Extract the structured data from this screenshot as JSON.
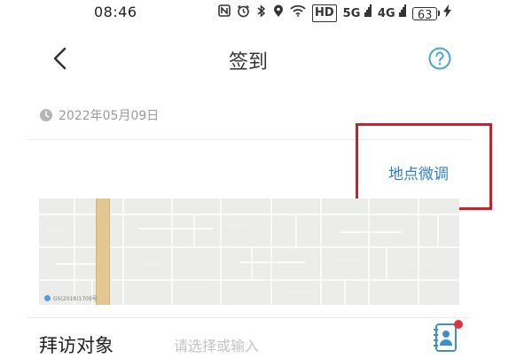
{
  "status_bar": {
    "time": "08:46",
    "network_1": "5G",
    "network_2": "4G",
    "battery": "63",
    "hd_badge": "HD"
  },
  "header": {
    "title": "签到"
  },
  "date": "2022年05月09日",
  "location_adjust": "地点微调",
  "map": {
    "credit": "GS(2018)1709号"
  },
  "visit_row": {
    "label": "拜访对象",
    "placeholder": "请选择或输入",
    "value": ""
  },
  "colors": {
    "accent": "#2f7fc5",
    "highlight": "#c8232c",
    "notification": "#e0333b"
  },
  "icons": {
    "back": "chevron-left-icon",
    "help": "question-circle-icon",
    "date": "clock-icon",
    "contact": "contact-card-icon"
  }
}
